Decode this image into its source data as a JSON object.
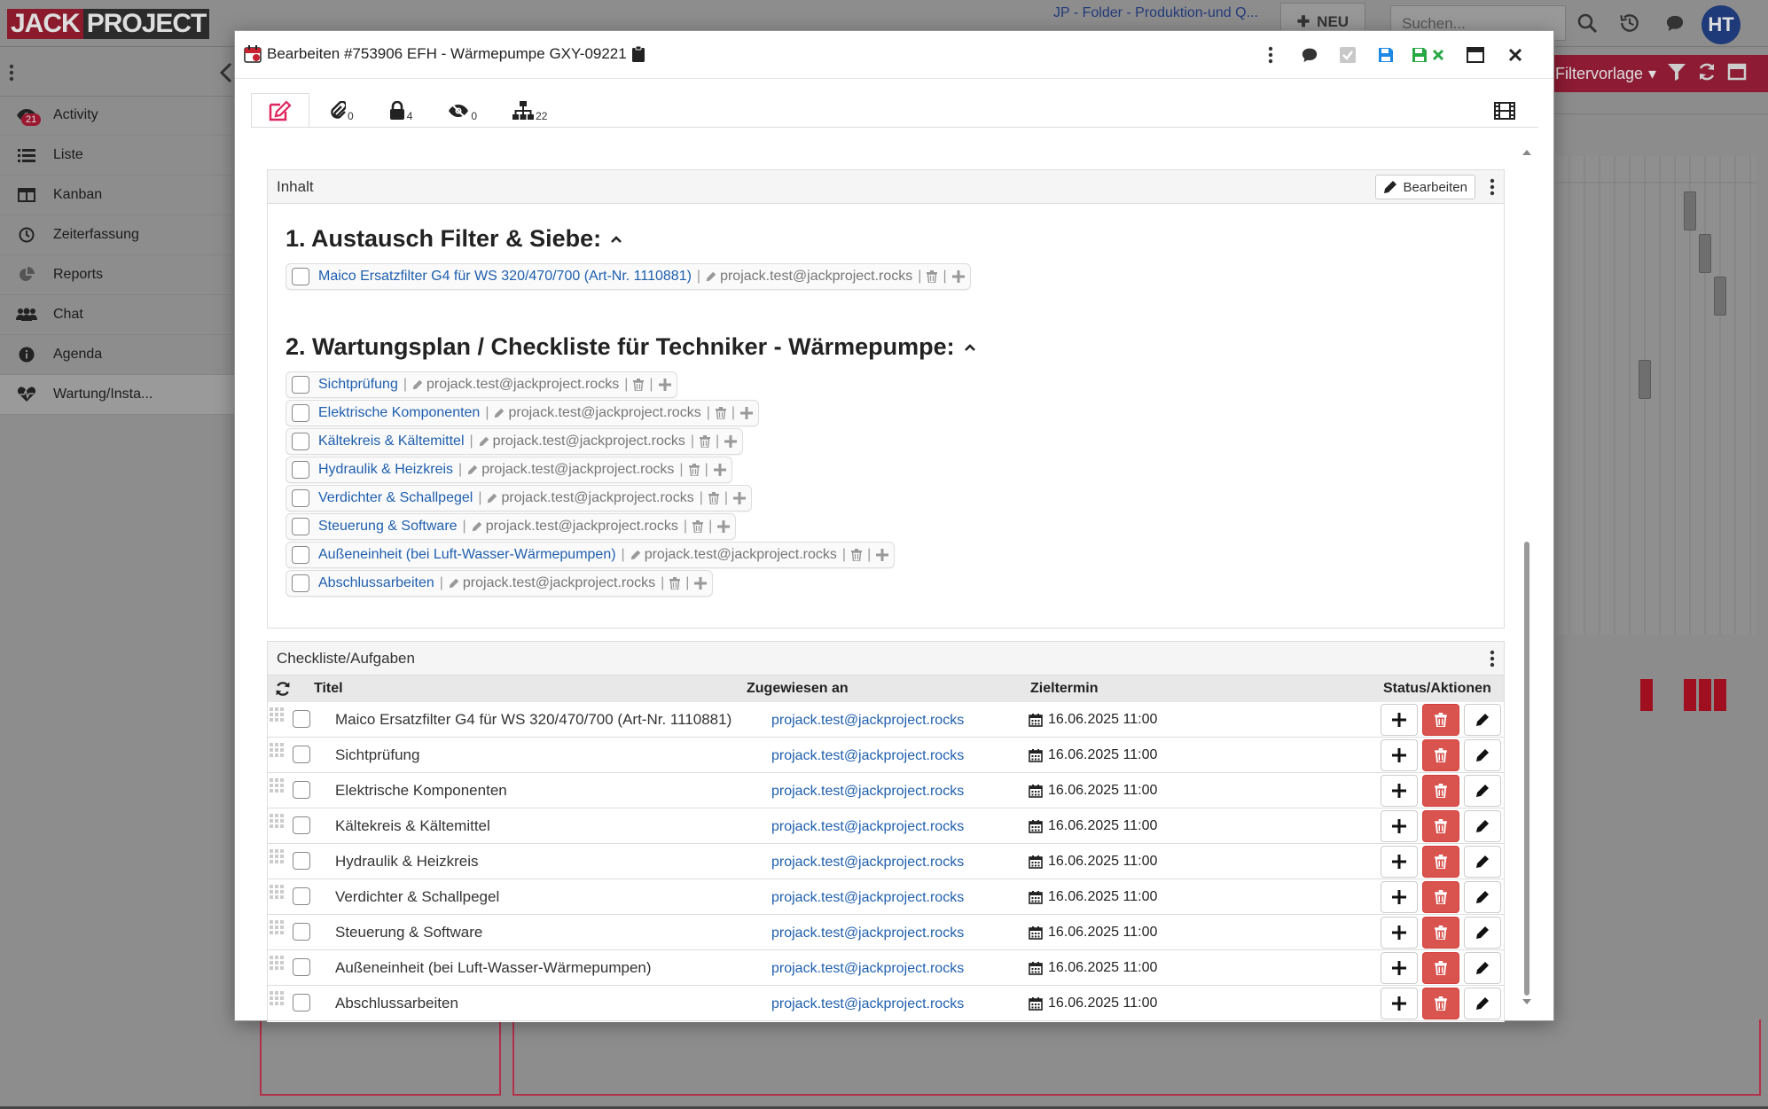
{
  "app": {
    "logo_left": "JACK",
    "logo_right": "PROJECT",
    "folder_text": "JP - Folder - Produktion-und Q...",
    "new_label": "NEU",
    "search_placeholder": "Suchen...",
    "avatar_initials": "HT",
    "filter_label": "Filtervorlage"
  },
  "sidebar": {
    "items": [
      {
        "label": "Activity",
        "icon": "eye-icon",
        "badge": "21"
      },
      {
        "label": "Liste",
        "icon": "list-icon"
      },
      {
        "label": "Kanban",
        "icon": "columns-icon"
      },
      {
        "label": "Zeiterfassung",
        "icon": "clock-icon"
      },
      {
        "label": "Reports",
        "icon": "pie-chart-icon"
      },
      {
        "label": "Chat",
        "icon": "users-icon"
      },
      {
        "label": "Agenda",
        "icon": "info-icon"
      },
      {
        "label": "Wartung/Insta...",
        "icon": "heartbeat-icon"
      }
    ]
  },
  "modal": {
    "title": "Bearbeiten #753906 EFH - Wärmepumpe GXY-09221",
    "tabs": [
      {
        "icon": "edit-icon",
        "count": ""
      },
      {
        "icon": "paperclip-icon",
        "count": "0"
      },
      {
        "icon": "lock-icon",
        "count": "4"
      },
      {
        "icon": "eye-slash-icon",
        "count": "0"
      },
      {
        "icon": "sitemap-icon",
        "count": "22"
      }
    ],
    "content_panel": {
      "title": "Inhalt",
      "edit_label": "Bearbeiten",
      "section1_heading": "1. Austausch Filter & Siebe:",
      "section1_items": [
        {
          "label": "Maico Ersatzfilter G4 für WS 320/470/700 (Art-Nr. 1110881)",
          "user": "projack.test@jackproject.rocks"
        }
      ],
      "section2_heading": "2. Wartungsplan / Checkliste für Techniker - Wärmepumpe:",
      "section2_items": [
        {
          "label": "Sichtprüfung",
          "user": "projack.test@jackproject.rocks"
        },
        {
          "label": "Elektrische Komponenten",
          "user": "projack.test@jackproject.rocks"
        },
        {
          "label": "Kältekreis & Kältemittel",
          "user": "projack.test@jackproject.rocks"
        },
        {
          "label": "Hydraulik & Heizkreis",
          "user": "projack.test@jackproject.rocks"
        },
        {
          "label": "Verdichter & Schallpegel",
          "user": "projack.test@jackproject.rocks"
        },
        {
          "label": "Steuerung & Software",
          "user": "projack.test@jackproject.rocks"
        },
        {
          "label": "Außeneinheit (bei Luft-Wasser-Wärmepumpen)",
          "user": "projack.test@jackproject.rocks"
        },
        {
          "label": "Abschlussarbeiten",
          "user": "projack.test@jackproject.rocks"
        }
      ]
    },
    "checklist_panel": {
      "title": "Checkliste/Aufgaben",
      "columns": {
        "title": "Titel",
        "assigned": "Zugewiesen an",
        "due": "Zieltermin",
        "status": "Status/Aktionen"
      },
      "rows": [
        {
          "title": "Maico Ersatzfilter G4 für WS 320/470/700 (Art-Nr. 1110881)",
          "assignee": "projack.test@jackproject.rocks",
          "due": "16.06.2025 11:00"
        },
        {
          "title": "Sichtprüfung",
          "assignee": "projack.test@jackproject.rocks",
          "due": "16.06.2025 11:00"
        },
        {
          "title": "Elektrische Komponenten",
          "assignee": "projack.test@jackproject.rocks",
          "due": "16.06.2025 11:00"
        },
        {
          "title": "Kältekreis & Kältemittel",
          "assignee": "projack.test@jackproject.rocks",
          "due": "16.06.2025 11:00"
        },
        {
          "title": "Hydraulik & Heizkreis",
          "assignee": "projack.test@jackproject.rocks",
          "due": "16.06.2025 11:00"
        },
        {
          "title": "Verdichter & Schallpegel",
          "assignee": "projack.test@jackproject.rocks",
          "due": "16.06.2025 11:00"
        },
        {
          "title": "Steuerung & Software",
          "assignee": "projack.test@jackproject.rocks",
          "due": "16.06.2025 11:00"
        },
        {
          "title": "Außeneinheit (bei Luft-Wasser-Wärmepumpen)",
          "assignee": "projack.test@jackproject.rocks",
          "due": "16.06.2025 11:00"
        },
        {
          "title": "Abschlussarbeiten",
          "assignee": "projack.test@jackproject.rocks",
          "due": "16.06.2025 11:00"
        }
      ]
    }
  },
  "colors": {
    "accent_red": "#d9534f",
    "link_blue": "#1f5fae",
    "brand_red": "#8c1b33"
  }
}
